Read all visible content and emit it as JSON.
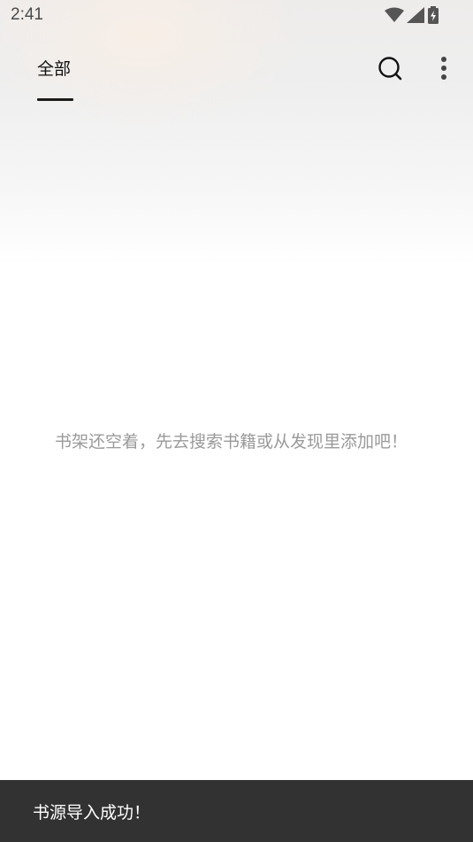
{
  "status_bar": {
    "time": "2:41",
    "icons": [
      "wifi-icon",
      "signal-icon",
      "battery-charging-icon"
    ]
  },
  "toolbar": {
    "tabs": [
      {
        "label": "全部",
        "selected": true
      }
    ],
    "actions": [
      "search-icon",
      "more-vert-icon"
    ]
  },
  "bookshelf": {
    "empty_message": "书架还空着，先去搜索书籍或从发现里添加吧！"
  },
  "snackbar": {
    "message": "书源导入成功！"
  },
  "colors": {
    "background": "#ffffff",
    "snackbar_bg": "#323232",
    "empty_text": "#9a9a9a",
    "tab_text": "#111111"
  }
}
